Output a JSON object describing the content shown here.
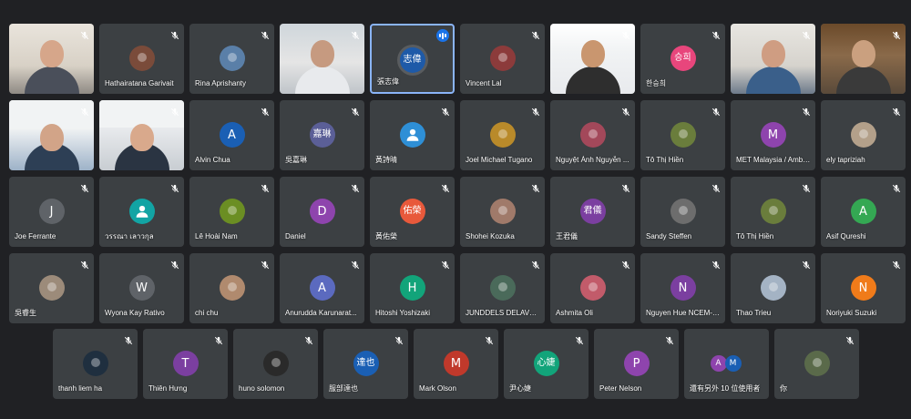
{
  "meeting": {
    "rows": [
      [
        {
          "name": "",
          "video": true,
          "muted": true,
          "scene": "man-glasses"
        },
        {
          "name": "Hathairatana Garivait",
          "avatar": "photo",
          "color": "#7a4b3a",
          "muted": true
        },
        {
          "name": "Rina Aprishanty",
          "avatar": "photo",
          "color": "#5a7fa8",
          "muted": true
        },
        {
          "name": "",
          "video": true,
          "muted": true,
          "scene": "man-white"
        },
        {
          "name": "張志偉",
          "avatar": "letter",
          "initial": "志偉",
          "color": "#1e5aa8",
          "speaking": true,
          "active": true
        },
        {
          "name": "Vincent Lal",
          "avatar": "photo",
          "color": "#8c3b3b",
          "muted": true
        },
        {
          "name": "",
          "video": true,
          "muted": true,
          "scene": "young-man"
        },
        {
          "name": "한승희",
          "avatar": "letter",
          "initial": "승희",
          "color": "#e8467c",
          "muted": true
        },
        {
          "name": "",
          "video": true,
          "muted": true,
          "scene": "man-blue"
        },
        {
          "name": "",
          "video": true,
          "muted": true,
          "scene": "man-beard"
        }
      ],
      [
        {
          "name": "",
          "video": true,
          "muted": true,
          "scene": "slide-man"
        },
        {
          "name": "",
          "video": true,
          "muted": true,
          "scene": "man-center"
        },
        {
          "name": "Alvin Chua",
          "avatar": "letter",
          "initial": "A",
          "color": "#1a5fb4",
          "muted": true
        },
        {
          "name": "吳嘉琳",
          "avatar": "letter",
          "initial": "嘉琳",
          "color": "#5b5f97",
          "muted": true
        },
        {
          "name": "黃詩晴",
          "avatar": "default",
          "color": "#2e8fd6",
          "muted": true
        },
        {
          "name": "Joel Michael Tugano",
          "avatar": "photo",
          "color": "#b98a2a",
          "muted": true
        },
        {
          "name": "Nguyệt Ánh Nguyễn ...",
          "avatar": "photo",
          "color": "#a3485a",
          "muted": true
        },
        {
          "name": "Tô Thị Hiền",
          "avatar": "photo",
          "color": "#6a7d3c",
          "muted": true
        },
        {
          "name": "MET Malaysia / Ambu...",
          "avatar": "letter",
          "initial": "M",
          "color": "#8e44ad",
          "muted": true
        },
        {
          "name": "ely tapriziah",
          "avatar": "photo",
          "color": "#b3a08a",
          "muted": true
        }
      ],
      [
        {
          "name": "Joe Ferrante",
          "avatar": "letter",
          "initial": "J",
          "color": "#5f6368",
          "muted": true
        },
        {
          "name": "วรรณา เลาวกุล",
          "avatar": "default",
          "color": "#12a4a4",
          "muted": true
        },
        {
          "name": "Lê Hoài Nam",
          "avatar": "photo",
          "color": "#6b8e23",
          "muted": true
        },
        {
          "name": "Daniel",
          "avatar": "letter",
          "initial": "D",
          "color": "#8e44ad",
          "muted": true
        },
        {
          "name": "黃佑榮",
          "avatar": "letter",
          "initial": "佑榮",
          "color": "#e8593b",
          "muted": true
        },
        {
          "name": "Shohei Kozuka",
          "avatar": "photo",
          "color": "#a07a6a",
          "muted": true
        },
        {
          "name": "王君儀",
          "avatar": "letter",
          "initial": "君儀",
          "color": "#7b3fa0",
          "muted": true
        },
        {
          "name": "Sandy Steffen",
          "avatar": "photo",
          "color": "#6d6d6d",
          "muted": true
        },
        {
          "name": "Tô Thị Hiền",
          "avatar": "photo",
          "color": "#6a7d3c",
          "muted": true
        },
        {
          "name": "Asif Qureshi",
          "avatar": "letter",
          "initial": "A",
          "color": "#34a853",
          "muted": true
        }
      ],
      [
        {
          "name": "吳睿生",
          "avatar": "photo",
          "color": "#9c8b7a",
          "muted": true
        },
        {
          "name": "Wyona Kay Rativo",
          "avatar": "letter",
          "initial": "W",
          "color": "#5f6368",
          "muted": true
        },
        {
          "name": "chi chu",
          "avatar": "photo",
          "color": "#b08a6e",
          "muted": true
        },
        {
          "name": "Anurudda Karunarat...",
          "avatar": "letter",
          "initial": "A",
          "color": "#5b6abf",
          "muted": true
        },
        {
          "name": "Hitoshi Yoshizaki",
          "avatar": "letter",
          "initial": "H",
          "color": "#12a47a",
          "muted": true
        },
        {
          "name": "JUNDDELS DELAVEGA",
          "avatar": "photo",
          "color": "#4a6a5a",
          "muted": true
        },
        {
          "name": "Ashmita Oli",
          "avatar": "photo",
          "color": "#c25b6a",
          "muted": true
        },
        {
          "name": "Nguyen Hue NCEM-V...",
          "avatar": "letter",
          "initial": "N",
          "color": "#7b3fa0",
          "muted": true
        },
        {
          "name": "Thao Trieu",
          "avatar": "photo",
          "color": "#a4b3c4",
          "muted": true
        },
        {
          "name": "Noriyuki Suzuki",
          "avatar": "letter",
          "initial": "N",
          "color": "#f07b1a",
          "muted": true
        }
      ],
      [
        {
          "name": "thanh liem ha",
          "avatar": "photo",
          "color": "#1f2f3f",
          "muted": true
        },
        {
          "name": "Thiên Hưng",
          "avatar": "letter",
          "initial": "T",
          "color": "#7b3fa0",
          "muted": true
        },
        {
          "name": "huno solomon",
          "avatar": "photo",
          "color": "#2a2a2a",
          "muted": true
        },
        {
          "name": "服部達也",
          "avatar": "letter",
          "initial": "達也",
          "color": "#1a5fb4",
          "muted": true
        },
        {
          "name": "Mark Olson",
          "avatar": "letter",
          "initial": "M",
          "color": "#c0392b",
          "muted": true
        },
        {
          "name": "尹心婕",
          "avatar": "letter",
          "initial": "心婕",
          "color": "#12a47a",
          "muted": true
        },
        {
          "name": "Peter Nelson",
          "avatar": "letter",
          "initial": "P",
          "color": "#8e44ad",
          "muted": true
        },
        {
          "name": "還有另外 10 位使用者",
          "avatar": "double",
          "initials": [
            "A",
            "M"
          ],
          "colors": [
            "#8e44ad",
            "#1a5fb4"
          ]
        },
        {
          "name": "你",
          "avatar": "photo",
          "color": "#5a6a4a",
          "muted": true
        }
      ]
    ]
  }
}
